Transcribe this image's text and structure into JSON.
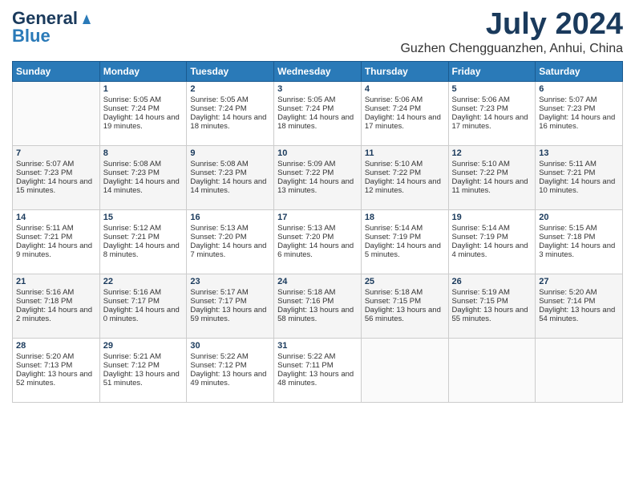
{
  "header": {
    "logo_general": "General",
    "logo_blue": "Blue",
    "month_year": "July 2024",
    "location": "Guzhen Chengguanzhen, Anhui, China"
  },
  "weekdays": [
    "Sunday",
    "Monday",
    "Tuesday",
    "Wednesday",
    "Thursday",
    "Friday",
    "Saturday"
  ],
  "weeks": [
    [
      {
        "day": "",
        "sunrise": "",
        "sunset": "",
        "daylight": ""
      },
      {
        "day": "1",
        "sunrise": "Sunrise: 5:05 AM",
        "sunset": "Sunset: 7:24 PM",
        "daylight": "Daylight: 14 hours and 19 minutes."
      },
      {
        "day": "2",
        "sunrise": "Sunrise: 5:05 AM",
        "sunset": "Sunset: 7:24 PM",
        "daylight": "Daylight: 14 hours and 18 minutes."
      },
      {
        "day": "3",
        "sunrise": "Sunrise: 5:05 AM",
        "sunset": "Sunset: 7:24 PM",
        "daylight": "Daylight: 14 hours and 18 minutes."
      },
      {
        "day": "4",
        "sunrise": "Sunrise: 5:06 AM",
        "sunset": "Sunset: 7:24 PM",
        "daylight": "Daylight: 14 hours and 17 minutes."
      },
      {
        "day": "5",
        "sunrise": "Sunrise: 5:06 AM",
        "sunset": "Sunset: 7:23 PM",
        "daylight": "Daylight: 14 hours and 17 minutes."
      },
      {
        "day": "6",
        "sunrise": "Sunrise: 5:07 AM",
        "sunset": "Sunset: 7:23 PM",
        "daylight": "Daylight: 14 hours and 16 minutes."
      }
    ],
    [
      {
        "day": "7",
        "sunrise": "Sunrise: 5:07 AM",
        "sunset": "Sunset: 7:23 PM",
        "daylight": "Daylight: 14 hours and 15 minutes."
      },
      {
        "day": "8",
        "sunrise": "Sunrise: 5:08 AM",
        "sunset": "Sunset: 7:23 PM",
        "daylight": "Daylight: 14 hours and 14 minutes."
      },
      {
        "day": "9",
        "sunrise": "Sunrise: 5:08 AM",
        "sunset": "Sunset: 7:23 PM",
        "daylight": "Daylight: 14 hours and 14 minutes."
      },
      {
        "day": "10",
        "sunrise": "Sunrise: 5:09 AM",
        "sunset": "Sunset: 7:22 PM",
        "daylight": "Daylight: 14 hours and 13 minutes."
      },
      {
        "day": "11",
        "sunrise": "Sunrise: 5:10 AM",
        "sunset": "Sunset: 7:22 PM",
        "daylight": "Daylight: 14 hours and 12 minutes."
      },
      {
        "day": "12",
        "sunrise": "Sunrise: 5:10 AM",
        "sunset": "Sunset: 7:22 PM",
        "daylight": "Daylight: 14 hours and 11 minutes."
      },
      {
        "day": "13",
        "sunrise": "Sunrise: 5:11 AM",
        "sunset": "Sunset: 7:21 PM",
        "daylight": "Daylight: 14 hours and 10 minutes."
      }
    ],
    [
      {
        "day": "14",
        "sunrise": "Sunrise: 5:11 AM",
        "sunset": "Sunset: 7:21 PM",
        "daylight": "Daylight: 14 hours and 9 minutes."
      },
      {
        "day": "15",
        "sunrise": "Sunrise: 5:12 AM",
        "sunset": "Sunset: 7:21 PM",
        "daylight": "Daylight: 14 hours and 8 minutes."
      },
      {
        "day": "16",
        "sunrise": "Sunrise: 5:13 AM",
        "sunset": "Sunset: 7:20 PM",
        "daylight": "Daylight: 14 hours and 7 minutes."
      },
      {
        "day": "17",
        "sunrise": "Sunrise: 5:13 AM",
        "sunset": "Sunset: 7:20 PM",
        "daylight": "Daylight: 14 hours and 6 minutes."
      },
      {
        "day": "18",
        "sunrise": "Sunrise: 5:14 AM",
        "sunset": "Sunset: 7:19 PM",
        "daylight": "Daylight: 14 hours and 5 minutes."
      },
      {
        "day": "19",
        "sunrise": "Sunrise: 5:14 AM",
        "sunset": "Sunset: 7:19 PM",
        "daylight": "Daylight: 14 hours and 4 minutes."
      },
      {
        "day": "20",
        "sunrise": "Sunrise: 5:15 AM",
        "sunset": "Sunset: 7:18 PM",
        "daylight": "Daylight: 14 hours and 3 minutes."
      }
    ],
    [
      {
        "day": "21",
        "sunrise": "Sunrise: 5:16 AM",
        "sunset": "Sunset: 7:18 PM",
        "daylight": "Daylight: 14 hours and 2 minutes."
      },
      {
        "day": "22",
        "sunrise": "Sunrise: 5:16 AM",
        "sunset": "Sunset: 7:17 PM",
        "daylight": "Daylight: 14 hours and 0 minutes."
      },
      {
        "day": "23",
        "sunrise": "Sunrise: 5:17 AM",
        "sunset": "Sunset: 7:17 PM",
        "daylight": "Daylight: 13 hours and 59 minutes."
      },
      {
        "day": "24",
        "sunrise": "Sunrise: 5:18 AM",
        "sunset": "Sunset: 7:16 PM",
        "daylight": "Daylight: 13 hours and 58 minutes."
      },
      {
        "day": "25",
        "sunrise": "Sunrise: 5:18 AM",
        "sunset": "Sunset: 7:15 PM",
        "daylight": "Daylight: 13 hours and 56 minutes."
      },
      {
        "day": "26",
        "sunrise": "Sunrise: 5:19 AM",
        "sunset": "Sunset: 7:15 PM",
        "daylight": "Daylight: 13 hours and 55 minutes."
      },
      {
        "day": "27",
        "sunrise": "Sunrise: 5:20 AM",
        "sunset": "Sunset: 7:14 PM",
        "daylight": "Daylight: 13 hours and 54 minutes."
      }
    ],
    [
      {
        "day": "28",
        "sunrise": "Sunrise: 5:20 AM",
        "sunset": "Sunset: 7:13 PM",
        "daylight": "Daylight: 13 hours and 52 minutes."
      },
      {
        "day": "29",
        "sunrise": "Sunrise: 5:21 AM",
        "sunset": "Sunset: 7:12 PM",
        "daylight": "Daylight: 13 hours and 51 minutes."
      },
      {
        "day": "30",
        "sunrise": "Sunrise: 5:22 AM",
        "sunset": "Sunset: 7:12 PM",
        "daylight": "Daylight: 13 hours and 49 minutes."
      },
      {
        "day": "31",
        "sunrise": "Sunrise: 5:22 AM",
        "sunset": "Sunset: 7:11 PM",
        "daylight": "Daylight: 13 hours and 48 minutes."
      },
      {
        "day": "",
        "sunrise": "",
        "sunset": "",
        "daylight": ""
      },
      {
        "day": "",
        "sunrise": "",
        "sunset": "",
        "daylight": ""
      },
      {
        "day": "",
        "sunrise": "",
        "sunset": "",
        "daylight": ""
      }
    ]
  ]
}
